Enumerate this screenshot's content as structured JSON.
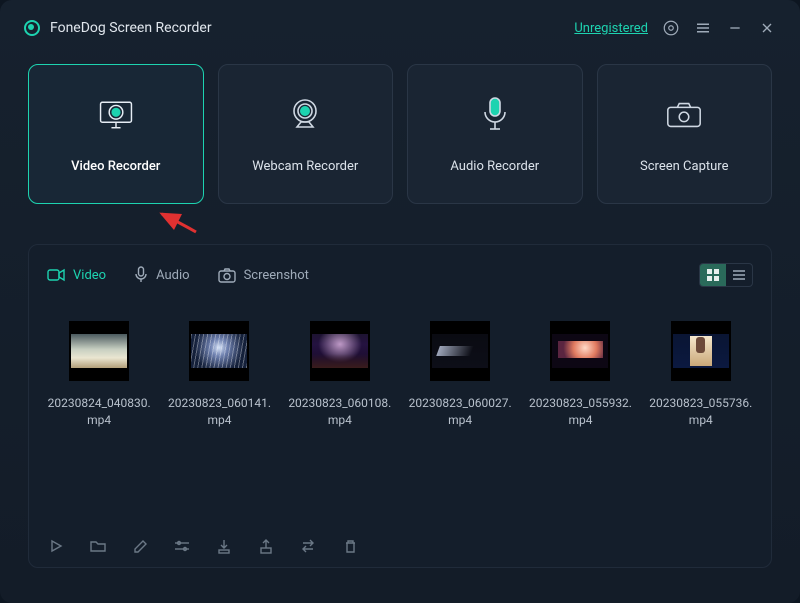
{
  "app": {
    "title": "FoneDog Screen Recorder"
  },
  "header": {
    "registration_text": "Unregistered"
  },
  "modes": [
    {
      "label": "Video Recorder"
    },
    {
      "label": "Webcam Recorder"
    },
    {
      "label": "Audio Recorder"
    },
    {
      "label": "Screen Capture"
    }
  ],
  "gallery": {
    "tabs": {
      "video": "Video",
      "audio": "Audio",
      "screenshot": "Screenshot"
    },
    "files": [
      {
        "name": "20230824_040830.mp4"
      },
      {
        "name": "20230823_060141.mp4"
      },
      {
        "name": "20230823_060108.mp4"
      },
      {
        "name": "20230823_060027.mp4"
      },
      {
        "name": "20230823_055932.mp4"
      },
      {
        "name": "20230823_055736.mp4"
      }
    ]
  }
}
